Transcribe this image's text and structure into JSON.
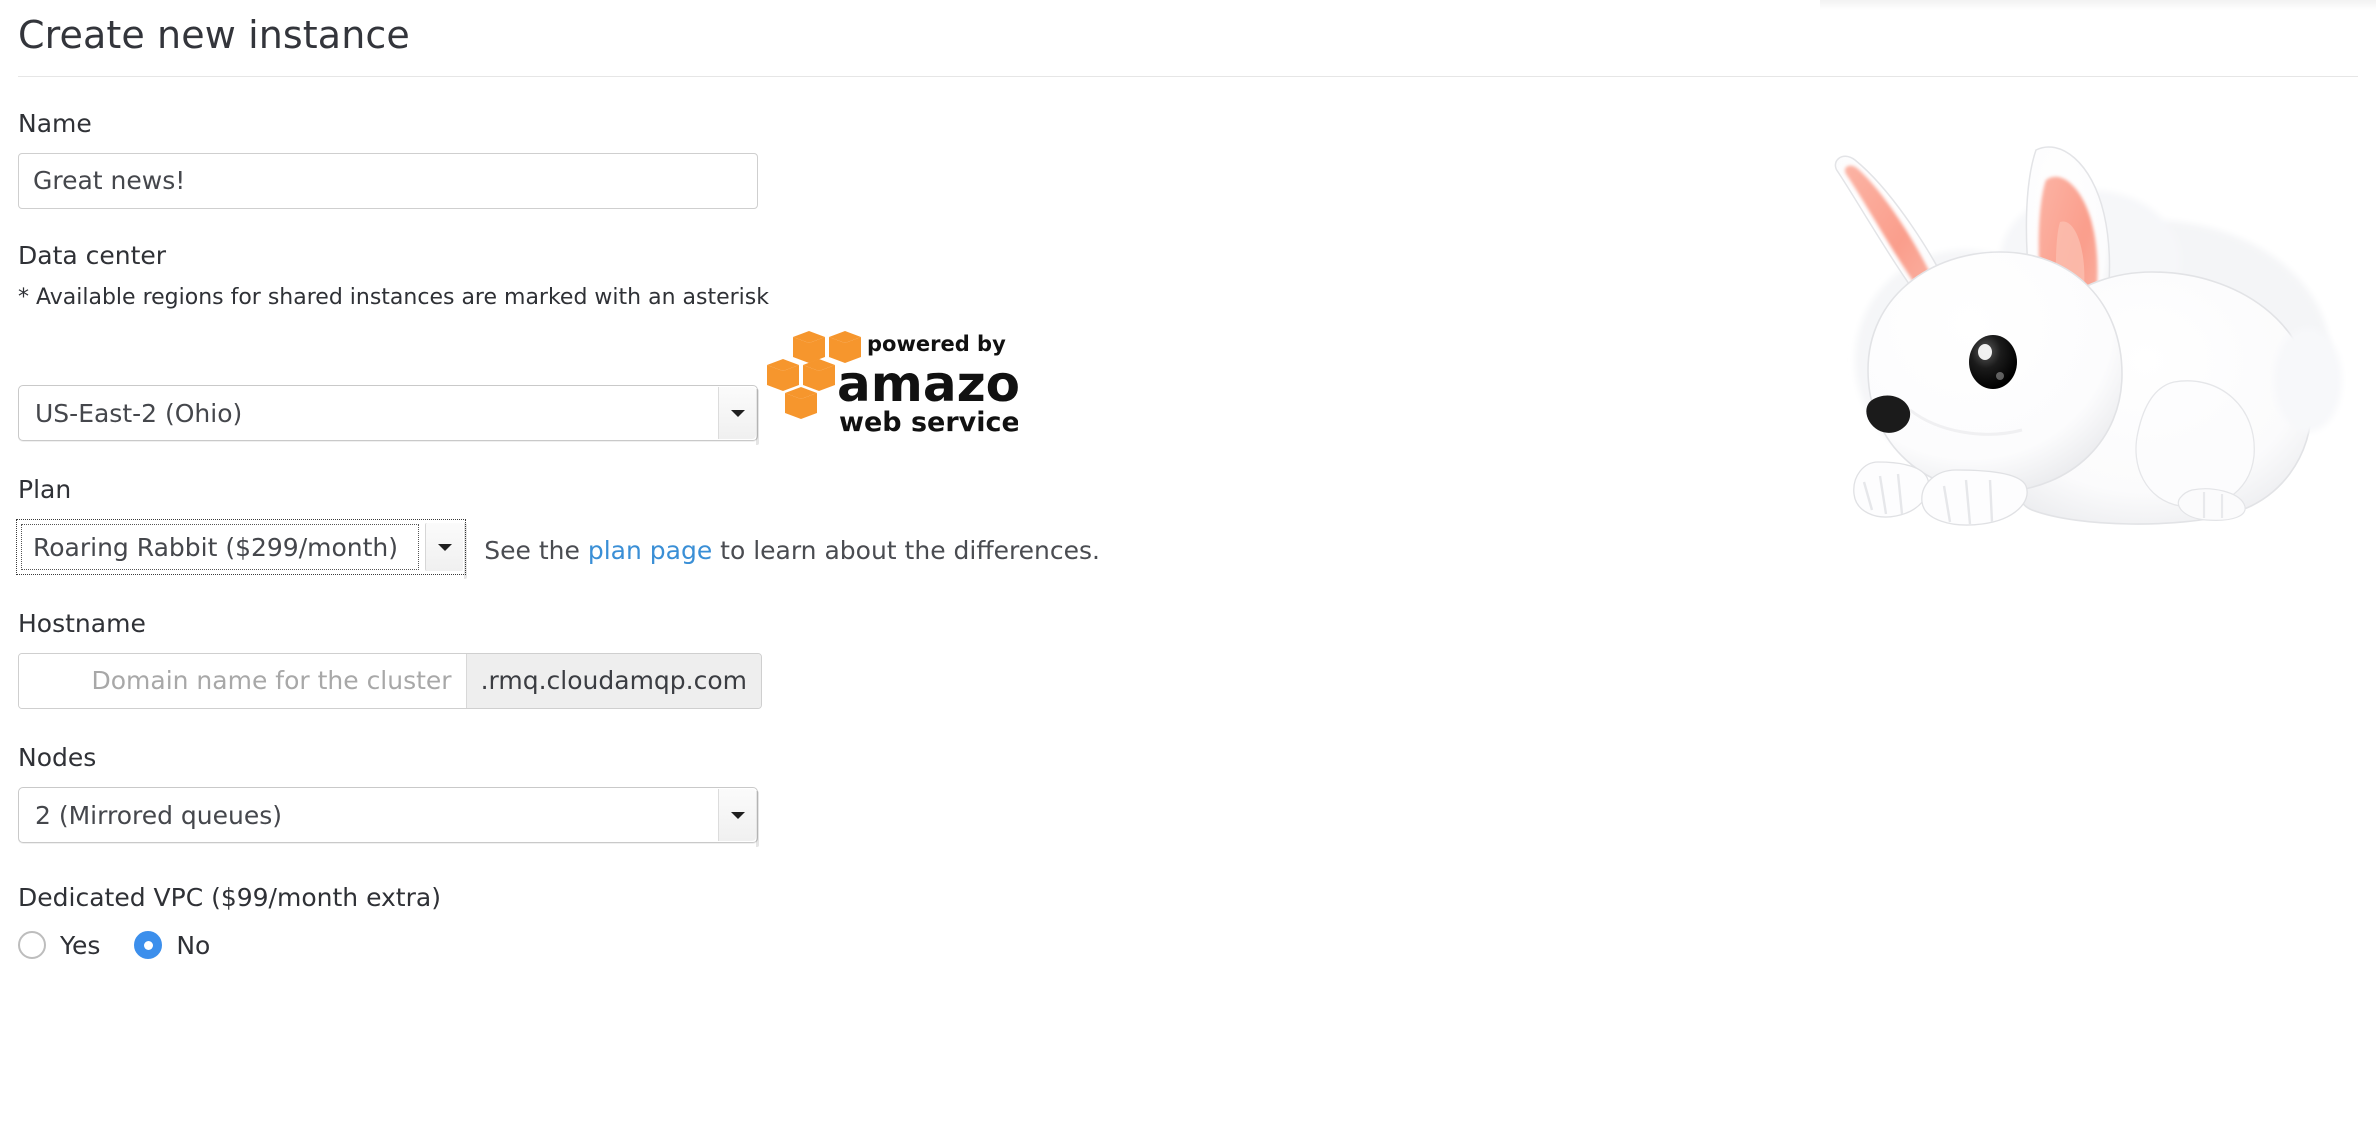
{
  "header": {
    "title": "Create new instance"
  },
  "form": {
    "name": {
      "label": "Name",
      "value": "Great news!",
      "placeholder": ""
    },
    "data_center": {
      "label": "Data center",
      "note": "* Available regions for shared instances are marked with an asterisk",
      "selected": "US-East-2 (Ohio)",
      "provider_logo": {
        "tagline": "powered by",
        "brand": "amazon",
        "sub": "web services",
        "logo_color": "#F6962D"
      }
    },
    "plan": {
      "label": "Plan",
      "selected": "Roaring Rabbit ($299/month)",
      "help_prefix": "See the ",
      "help_link": "plan page",
      "help_suffix": " to learn about the differences.",
      "link_color": "#3a8fd6"
    },
    "hostname": {
      "label": "Hostname",
      "value": "",
      "placeholder": "Domain name for the cluster",
      "suffix": ".rmq.cloudamqp.com"
    },
    "nodes": {
      "label": "Nodes",
      "selected": "2 (Mirrored queues)"
    },
    "vpc": {
      "label": "Dedicated VPC ($99/month extra)",
      "options": [
        {
          "label": "Yes",
          "checked": false
        },
        {
          "label": "No",
          "checked": true
        }
      ],
      "accent_color": "#3c8fec"
    }
  },
  "illustration": {
    "name": "white-rabbit",
    "body_color": "#ffffff",
    "ear_inner_color": "#fba393",
    "eye_color": "#141414",
    "nose_color": "#1b1b1b"
  }
}
